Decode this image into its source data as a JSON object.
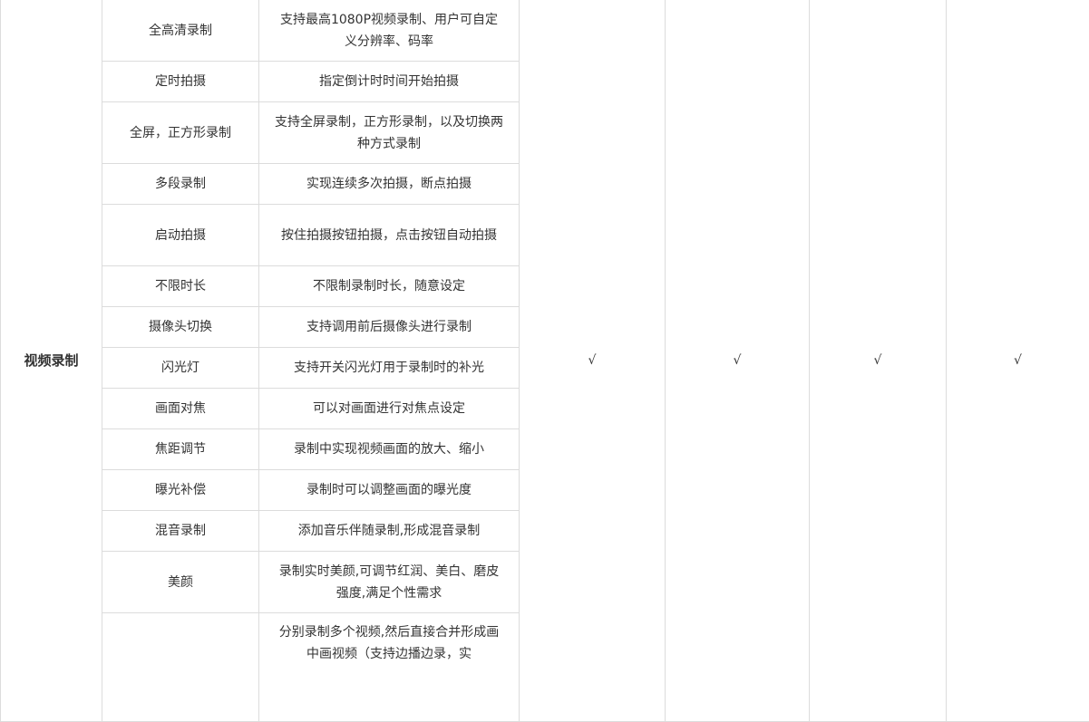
{
  "category": "视频录制",
  "checks": [
    "√",
    "√",
    "√",
    "√"
  ],
  "rows": [
    {
      "feature": "全高清录制",
      "desc": "支持最高1080P视频录制、用户可自定义分辨率、码率"
    },
    {
      "feature": "定时拍摄",
      "desc": "指定倒计时时间开始拍摄"
    },
    {
      "feature": "全屏，正方形录制",
      "desc": "支持全屏录制，正方形录制，以及切换两种方式录制"
    },
    {
      "feature": "多段录制",
      "desc": "实现连续多次拍摄，断点拍摄"
    },
    {
      "feature": "启动拍摄",
      "desc": "按住拍摄按钮拍摄，点击按钮自动拍摄"
    },
    {
      "feature": "不限时长",
      "desc": "不限制录制时长，随意设定"
    },
    {
      "feature": "摄像头切换",
      "desc": "支持调用前后摄像头进行录制"
    },
    {
      "feature": "闪光灯",
      "desc": "支持开关闪光灯用于录制时的补光"
    },
    {
      "feature": "画面对焦",
      "desc": "可以对画面进行对焦点设定"
    },
    {
      "feature": "焦距调节",
      "desc": "录制中实现视频画面的放大、缩小"
    },
    {
      "feature": "曝光补偿",
      "desc": "录制时可以调整画面的曝光度"
    },
    {
      "feature": "混音录制",
      "desc": "添加音乐伴随录制,形成混音录制"
    },
    {
      "feature": "美颜",
      "desc": "录制实时美颜,可调节红润、美白、磨皮强度,满足个性需求"
    },
    {
      "feature": "",
      "desc": "分别录制多个视频,然后直接合并形成画中画视频（支持边播边录，实"
    }
  ]
}
